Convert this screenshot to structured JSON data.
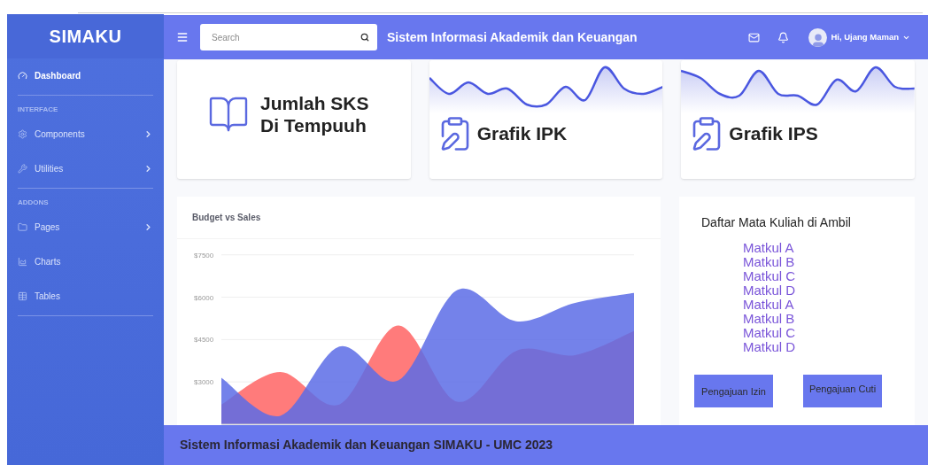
{
  "brand": "SIMAKU",
  "sidebar": {
    "items": [
      {
        "kind": "link",
        "label": "Dashboard",
        "selected": true,
        "submenu": false
      },
      {
        "kind": "divider"
      },
      {
        "kind": "heading",
        "label": "INTERFACE"
      },
      {
        "kind": "link",
        "label": "Components",
        "selected": false,
        "submenu": true
      },
      {
        "kind": "link",
        "label": "Utilities",
        "selected": false,
        "submenu": true
      },
      {
        "kind": "divider"
      },
      {
        "kind": "heading",
        "label": "ADDONS"
      },
      {
        "kind": "link",
        "label": "Pages",
        "selected": false,
        "submenu": true
      },
      {
        "kind": "link",
        "label": "Charts",
        "selected": false,
        "submenu": false
      },
      {
        "kind": "link",
        "label": "Tables",
        "selected": false,
        "submenu": false
      },
      {
        "kind": "divider"
      }
    ]
  },
  "topbar": {
    "search": {
      "placeholder": "Search"
    },
    "title": "Sistem Informasi Akademik dan Keuangan",
    "user": "Hi, Ujang Maman"
  },
  "cards": [
    {
      "kind": "book",
      "title": "Jumlah SKS Di Tempuuh"
    },
    {
      "kind": "wave",
      "title": "Grafik IPK"
    },
    {
      "kind": "wave",
      "title": "Grafik IPS"
    }
  ],
  "chart_card": {
    "title": "Budget vs Sales",
    "chart_data": {
      "type": "area",
      "grid": true,
      "ylim": [
        1500,
        7500
      ],
      "yticks": [
        {
          "value": 3000,
          "label": "$3000"
        },
        {
          "value": 4500,
          "label": "$4500"
        },
        {
          "value": 6000,
          "label": "$6000"
        },
        {
          "value": 7500,
          "label": "$7500"
        }
      ],
      "series": [
        {
          "color": "#ff7b7b",
          "values": [
            2200,
            3350,
            2200,
            5000,
            2300,
            4100,
            3950,
            4800
          ]
        },
        {
          "color": "#5c6ce6",
          "values": [
            3150,
            1800,
            4250,
            3050,
            6250,
            5150,
            5800,
            6150
          ]
        }
      ]
    }
  },
  "courses": {
    "title": "Daftar Mata Kuliah di Ambil",
    "items": [
      "Matkul A",
      "Matkul B",
      "Matkul C",
      "Matkul D",
      "Matkul A",
      "Matkul B",
      "Matkul C",
      "Matkul D"
    ],
    "buttons": [
      "Pengajuan Izin",
      "Pengajuan Cuti"
    ]
  },
  "footer": "Sistem Informasi Akademik dan Keuangan SIMAKU - UMC 2023"
}
